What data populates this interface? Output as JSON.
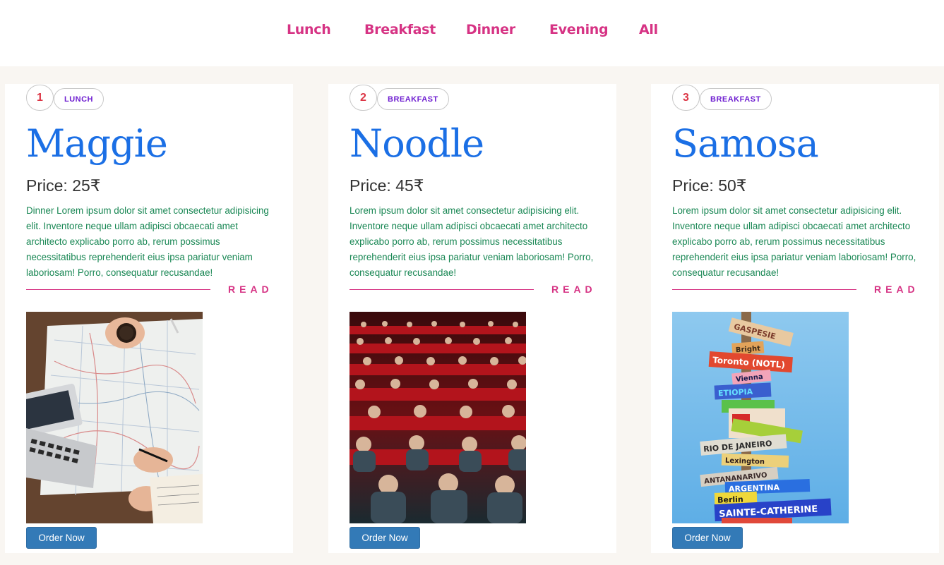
{
  "nav": {
    "items": [
      {
        "label": "Lunch"
      },
      {
        "label": "Breakfast"
      },
      {
        "label": "Dinner"
      },
      {
        "label": "Evening"
      },
      {
        "label": "All"
      }
    ]
  },
  "cards": [
    {
      "number": "1",
      "category": "LUNCH",
      "title": "Maggie",
      "price_label": "Price:",
      "price_value": "25₹",
      "description": "Dinner Lorem ipsum dolor sit amet consectetur adipisicing elit. Inventore neque ullam adipisci obcaecati amet architecto explicabo porro ab, rerum possimus necessitatibus reprehenderit eius ipsa pariatur veniam laboriosam! Porro, consequatur recusandae!",
      "read_label": "READ",
      "image_name": "travel-map-laptop-photo",
      "order_label": "Order Now"
    },
    {
      "number": "2",
      "category": "BREAKFAST",
      "title": "Noodle",
      "price_label": "Price:",
      "price_value": "45₹",
      "description": "Lorem ipsum dolor sit amet consectetur adipisicing elit. Inventore neque ullam adipisci obcaecati amet architecto explicabo porro ab, rerum possimus necessitatibus reprehenderit eius ipsa pariatur veniam laboriosam! Porro, consequatur recusandae!",
      "read_label": "READ",
      "image_name": "cinema-audience-photo",
      "order_label": "Order Now"
    },
    {
      "number": "3",
      "category": "BREAKFAST",
      "title": "Samosa",
      "price_label": "Price:",
      "price_value": "50₹",
      "description": "Lorem ipsum dolor sit amet consectetur adipisicing elit. Inventore neque ullam adipisci obcaecati amet architecto explicabo porro ab, rerum possimus necessitatibus reprehenderit eius ipsa pariatur veniam laboriosam! Porro, consequatur recusandae!",
      "read_label": "READ",
      "image_name": "signpost-destinations-photo",
      "order_label": "Order Now"
    }
  ],
  "signpost_labels": [
    "GASPESIE",
    "Bright",
    "Toronto (NOTL)",
    "Vienna",
    "ETIOPIA",
    "RIO DE JANEIRO",
    "Lexington",
    "ANTANANARIVO",
    "ARGENTINA",
    "Berlin",
    "SAINTE-CATHERINE"
  ],
  "colors": {
    "nav_link": "#d63384",
    "title": "#1b6fe5",
    "description": "#198754",
    "badge_number": "#dc3545",
    "badge_category": "#6f1fd1",
    "order_button": "#337ab7",
    "page_bg": "#f9f6f2"
  }
}
